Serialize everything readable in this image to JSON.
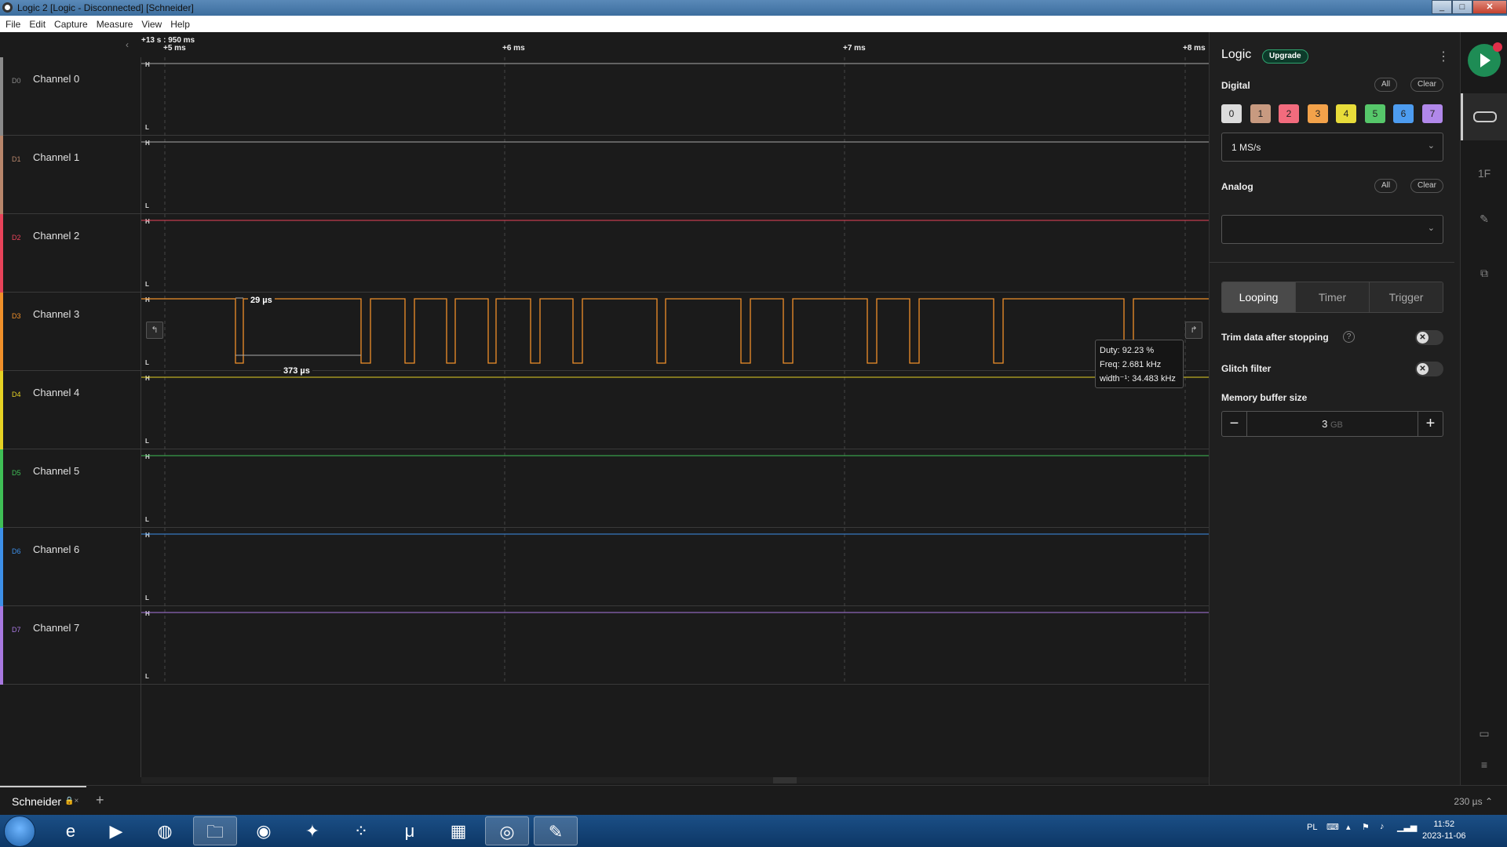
{
  "window": {
    "title": "Logic 2 [Logic - Disconnected] [Schneider]"
  },
  "menu": [
    "File",
    "Edit",
    "Capture",
    "Measure",
    "View",
    "Help"
  ],
  "timeline": {
    "origin": "+13 s : 950 ms",
    "ticks": [
      "+5 ms",
      "+6 ms",
      "+7 ms",
      "+8 ms"
    ]
  },
  "channels": [
    {
      "id": "D0",
      "name": "Channel 0",
      "color": "#8a8a8a"
    },
    {
      "id": "D1",
      "name": "Channel 1",
      "color": "#b8866b"
    },
    {
      "id": "D2",
      "name": "Channel 2",
      "color": "#e8435a"
    },
    {
      "id": "D3",
      "name": "Channel 3",
      "color": "#f0902a"
    },
    {
      "id": "D4",
      "name": "Channel 4",
      "color": "#e6d224"
    },
    {
      "id": "D5",
      "name": "Channel 5",
      "color": "#3fbf56"
    },
    {
      "id": "D6",
      "name": "Channel 6",
      "color": "#3d8fe8"
    },
    {
      "id": "D7",
      "name": "Channel 7",
      "color": "#a878e0"
    }
  ],
  "level_labels": {
    "high": "H",
    "low": "L"
  },
  "measurements": {
    "pulse_width": "29 µs",
    "period": "373 µs",
    "tooltip": {
      "duty": "Duty: 92.23 %",
      "freq": "Freq: 2.681 kHz",
      "width": "width⁻¹: 34.483 kHz"
    }
  },
  "panel": {
    "title": "Logic",
    "upgrade": "Upgrade",
    "digital": {
      "label": "Digital",
      "all": "All",
      "clear": "Clear",
      "channels": [
        "0",
        "1",
        "2",
        "3",
        "4",
        "5",
        "6",
        "7"
      ],
      "channel_colors": [
        "#dcdcdc",
        "#c89a80",
        "#f26b7d",
        "#f3a24a",
        "#e8dc3a",
        "#56c76a",
        "#4d9cf0",
        "#b188ea"
      ],
      "sample_rate": "1 MS/s"
    },
    "analog": {
      "label": "Analog",
      "all": "All",
      "clear": "Clear",
      "sample_rate": ""
    },
    "modes": [
      "Looping",
      "Timer",
      "Trigger"
    ],
    "active_mode": "Looping",
    "trim": {
      "label": "Trim data after stopping",
      "help": "?",
      "enabled": false
    },
    "glitch": {
      "label": "Glitch filter",
      "enabled": false
    },
    "memory": {
      "label": "Memory buffer size",
      "value": "3",
      "unit": "GB",
      "minus": "−",
      "plus": "+"
    }
  },
  "session": {
    "tab": "Schneider",
    "add": "+",
    "zoom": "230 µs"
  },
  "taskbar": {
    "lang": "PL",
    "time": "11:52",
    "date": "2023-11-06"
  },
  "icons": {
    "play": "play-icon",
    "device": "device-icon",
    "analyzers": "analyzers-icon",
    "measure": "ruler-icon",
    "extensions": "extensions-icon",
    "feedback": "chat-icon",
    "menu": "hamburger-icon"
  }
}
